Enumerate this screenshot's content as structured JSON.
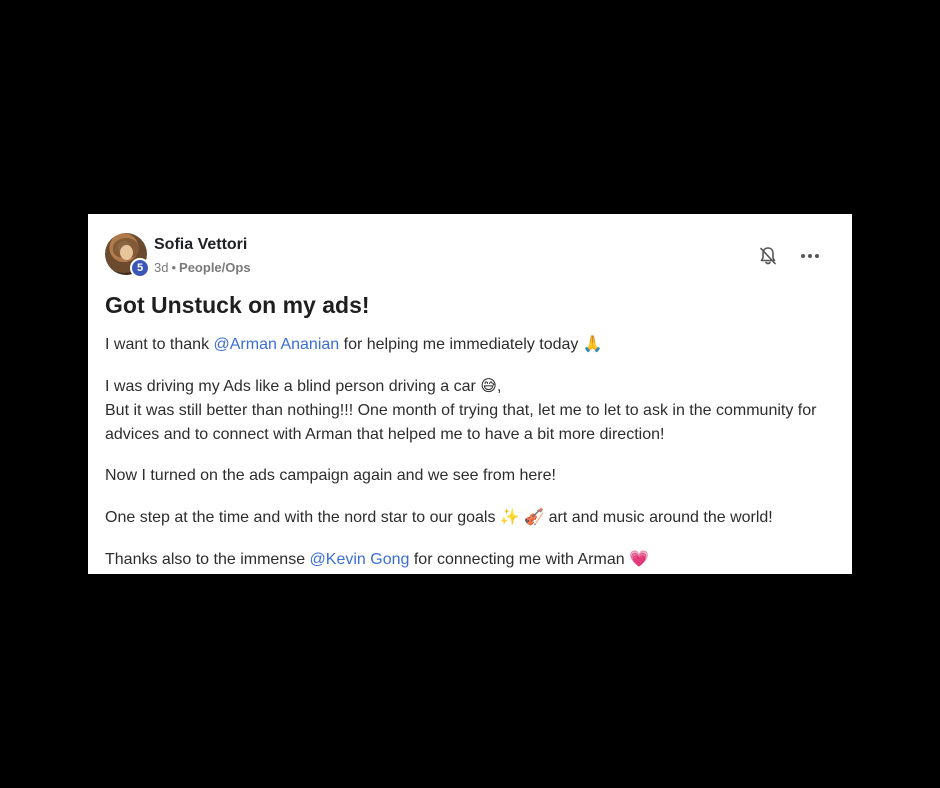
{
  "post": {
    "author": {
      "name": "Sofia Vettori",
      "level": "5"
    },
    "time": "3d",
    "separator": "•",
    "category": "People/Ops",
    "title": "Got Unstuck on my ads!",
    "paragraphs": {
      "p1": {
        "before": "I want to thank ",
        "mention": "@Arman Ananian",
        "after": " for helping me immediately today ",
        "emoji": "🙏"
      },
      "p2": {
        "line1": "I was driving my Ads like a blind person driving a car ",
        "emoji": "😅",
        "line1_end": ",",
        "line2": "But it was still better than nothing!!! One month of trying that, let me to let to ask in the community for advices and to connect with Arman that helped me to have a bit more direction!"
      },
      "p3": {
        "text": "Now I turned on the ads campaign again and we see from here!"
      },
      "p4": {
        "before": "One step at the time and with the nord star to our goals ",
        "emoji1": "✨",
        "emoji2": "🎻",
        "after": "  art and music around the world!"
      },
      "p5": {
        "before": "Thanks also to the immense ",
        "mention": "@Kevin Gong",
        "after": " for connecting me with Arman ",
        "emoji": "💗"
      }
    }
  },
  "icons": {
    "bell": "bell-off-icon",
    "more": "more-horizontal-icon"
  },
  "colors": {
    "mention": "#3a6fd8",
    "badge": "#3b56b8",
    "background": "#000000",
    "card": "#ffffff"
  }
}
